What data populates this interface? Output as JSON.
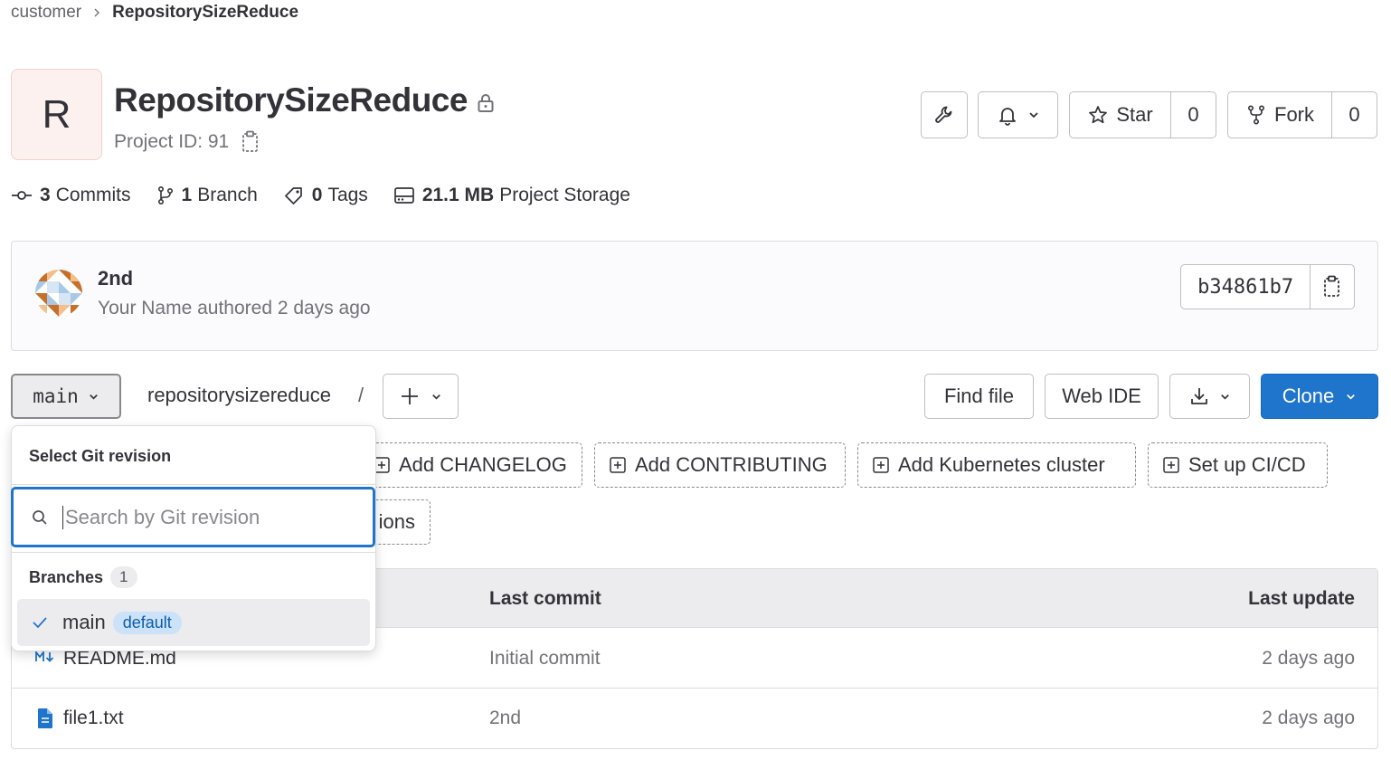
{
  "breadcrumb": {
    "parent": "customer",
    "current": "RepositorySizeReduce"
  },
  "project": {
    "avatar_letter": "R",
    "name": "RepositorySizeReduce",
    "id_label": "Project ID: 91"
  },
  "header_actions": {
    "star_label": "Star",
    "star_count": "0",
    "fork_label": "Fork",
    "fork_count": "0"
  },
  "stats": {
    "commits_count": "3",
    "commits_label": "Commits",
    "branches_count": "1",
    "branches_label": "Branch",
    "tags_count": "0",
    "tags_label": "Tags",
    "storage_size": "21.1 MB",
    "storage_label": "Project Storage"
  },
  "last_commit": {
    "title": "2nd",
    "meta": "Your Name authored 2 days ago",
    "sha": "b34861b7"
  },
  "toolbar": {
    "branch": "main",
    "path": "repositorysizereduce",
    "path_separator": "/",
    "find_file": "Find file",
    "web_ide": "Web IDE",
    "clone": "Clone"
  },
  "suggestions": [
    {
      "label": "Add CHANGELOG"
    },
    {
      "label": "Add CONTRIBUTING"
    },
    {
      "label": "Add Kubernetes cluster"
    },
    {
      "label": "Set up CI/CD"
    },
    {
      "label": "ions"
    }
  ],
  "file_table": {
    "headers": {
      "last_commit": "Last commit",
      "last_update": "Last update"
    },
    "rows": [
      {
        "name": "README.md",
        "commit": "Initial commit",
        "updated": "2 days ago",
        "icon": "markdown-icon"
      },
      {
        "name": "file1.txt",
        "commit": "2nd",
        "updated": "2 days ago",
        "icon": "file-icon"
      }
    ]
  },
  "revision_dropdown": {
    "title": "Select Git revision",
    "search_placeholder": "Search by Git revision",
    "section_label": "Branches",
    "section_count": "1",
    "items": [
      {
        "name": "main",
        "badge": "default",
        "selected": true
      }
    ]
  },
  "colors": {
    "primary": "#1f75cb",
    "text": "#333238",
    "muted": "#737278",
    "border": "#bfbfc3"
  }
}
